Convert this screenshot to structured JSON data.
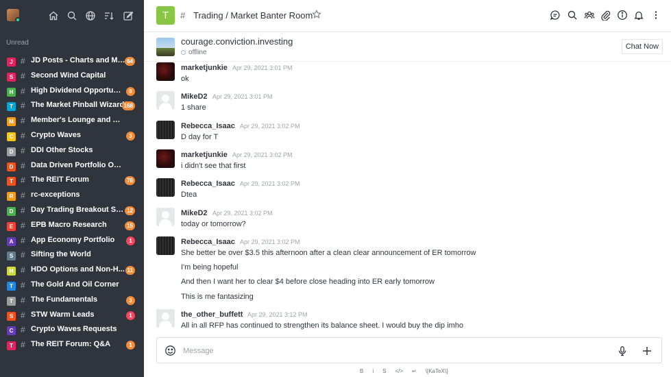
{
  "sidebar": {
    "unread_label": "Unread",
    "top_icons": [
      "home-icon",
      "search-icon",
      "directory-icon",
      "sort-icon",
      "write-icon"
    ],
    "rooms": [
      {
        "letter": "J",
        "color": "#e0245e",
        "name": "JD Posts - Charts and Mo...",
        "badge": "64",
        "badge_color": "#f38c39"
      },
      {
        "letter": "S",
        "color": "#e0245e",
        "name": "Second Wind Capital",
        "badge": "",
        "badge_color": ""
      },
      {
        "letter": "H",
        "color": "#4caf50",
        "name": "High Dividend Opportunit...",
        "badge": "8",
        "badge_color": "#f38c39"
      },
      {
        "letter": "T",
        "color": "#00a6d6",
        "name": "The Market Pinball Wizard",
        "badge": "168",
        "badge_color": "#f38c39"
      },
      {
        "letter": "M",
        "color": "#f59c1a",
        "name": "Member's Lounge and Discu...",
        "badge": "",
        "badge_color": ""
      },
      {
        "letter": "C",
        "color": "#f5c518",
        "name": "Crypto Waves",
        "badge": "3",
        "badge_color": "#f38c39"
      },
      {
        "letter": "D",
        "color": "#9e9e9e",
        "name": "DDI Other Stocks",
        "badge": "",
        "badge_color": ""
      },
      {
        "letter": "D",
        "color": "#f4511e",
        "name": "Data Driven Portfolio Only- ...",
        "badge": "",
        "badge_color": ""
      },
      {
        "letter": "T",
        "color": "#f4511e",
        "name": "The REIT Forum",
        "badge": "76",
        "badge_color": "#f38c39"
      },
      {
        "letter": "R",
        "color": "#f59c1a",
        "name": "rc-exceptions",
        "badge": "",
        "badge_color": ""
      },
      {
        "letter": "D",
        "color": "#4caf50",
        "name": "Day Trading Breakout Sto...",
        "badge": "12",
        "badge_color": "#f38c39"
      },
      {
        "letter": "E",
        "color": "#f44336",
        "name": "EPB Macro Research",
        "badge": "15",
        "badge_color": "#f38c39"
      },
      {
        "letter": "A",
        "color": "#673ab7",
        "name": "App Economy Portfolio",
        "badge": "1",
        "badge_color": "#f5455c"
      },
      {
        "letter": "S",
        "color": "#607d8b",
        "name": "Sifting the World",
        "badge": "",
        "badge_color": ""
      },
      {
        "letter": "H",
        "color": "#cddc39",
        "name": "HDO Options and Non-H...",
        "badge": "11",
        "badge_color": "#f38c39"
      },
      {
        "letter": "T",
        "color": "#1e88e5",
        "name": "The Gold And Oil Corner",
        "badge": "",
        "badge_color": ""
      },
      {
        "letter": "T",
        "color": "#9e9e9e",
        "name": "The Fundamentals",
        "badge": "3",
        "badge_color": "#f38c39"
      },
      {
        "letter": "S",
        "color": "#f4511e",
        "name": "STW Warm Leads",
        "badge": "1",
        "badge_color": "#f5455c"
      },
      {
        "letter": "C",
        "color": "#673ab7",
        "name": "Crypto Waves Requests",
        "badge": "",
        "badge_color": ""
      },
      {
        "letter": "T",
        "color": "#e0245e",
        "name": "The REIT Forum: Q&A",
        "badge": "1",
        "badge_color": "#f38c39"
      }
    ]
  },
  "header": {
    "room_letter": "T",
    "room_title": "Trading / Market Banter Room",
    "icons": [
      "discussion-icon",
      "search-icon",
      "members-icon",
      "attachment-icon",
      "info-icon",
      "bell-icon",
      "kebab-icon"
    ]
  },
  "contact": {
    "name": "courage.conviction.investing",
    "status": "offline",
    "chat_now_label": "Chat Now"
  },
  "messages": [
    {
      "user": "marketjunkie",
      "time": "Apr 29, 2021 3:01 PM",
      "avatar": "dark-red",
      "lines": [
        "ok"
      ]
    },
    {
      "user": "MikeD2",
      "time": "Apr 29, 2021 3:01 PM",
      "avatar": "grey",
      "lines": [
        "1 share"
      ]
    },
    {
      "user": "Rebecca_Isaac",
      "time": "Apr 29, 2021 3:02 PM",
      "avatar": "hair",
      "lines": [
        "D day for T"
      ]
    },
    {
      "user": "marketjunkie",
      "time": "Apr 29, 2021 3:02 PM",
      "avatar": "dark-red",
      "lines": [
        "i didn't see that first"
      ]
    },
    {
      "user": "Rebecca_Isaac",
      "time": "Apr 29, 2021 3:02 PM",
      "avatar": "hair",
      "lines": [
        "Dtea"
      ]
    },
    {
      "user": "MikeD2",
      "time": "Apr 29, 2021 3:02 PM",
      "avatar": "grey",
      "lines": [
        "today or tomorrow?"
      ]
    },
    {
      "user": "Rebecca_Isaac",
      "time": "Apr 29, 2021 3:02 PM",
      "avatar": "hair",
      "lines": [
        "She better be over $3.5 this afternoon after a clean clear announcement of ER tomorrow",
        "I'm being hopeful",
        "And then I want her to clear $4 before close heading into ER early tomorrow",
        "This is me fantasizing"
      ]
    },
    {
      "user": "the_other_buffett",
      "time": "Apr 29, 2021 3:12 PM",
      "avatar": "grey",
      "lines": [
        "All in all RFP has continued to strengthen its balance sheet. I would buy the dip imho"
      ]
    }
  ],
  "composer": {
    "placeholder": "Message",
    "format_items": [
      "B",
      "i",
      "S",
      "</>",
      "↵",
      "\\[KaTeX\\]"
    ]
  }
}
